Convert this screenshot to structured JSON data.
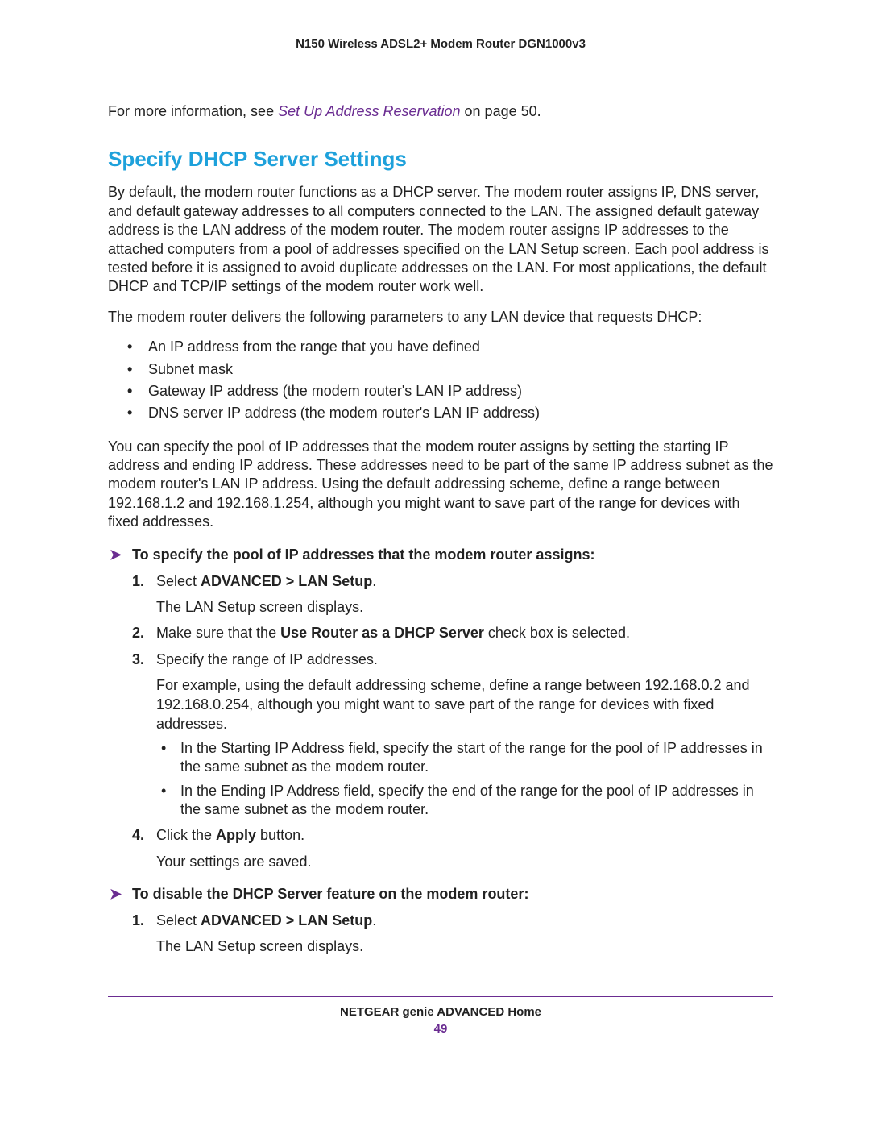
{
  "header": {
    "title": "N150 Wireless ADSL2+ Modem Router DGN1000v3"
  },
  "intro": {
    "prefix": "For more information, see ",
    "link_text": "Set Up Address Reservation",
    "suffix": " on page 50."
  },
  "heading": "Specify DHCP Server Settings",
  "p1": "By default, the modem router functions as a DHCP server. The modem router assigns IP, DNS server, and default gateway addresses to all computers connected to the LAN. The assigned default gateway address is the LAN address of the modem router. The modem router assigns IP addresses to the attached computers from a pool of addresses specified on the LAN Setup screen. Each pool address is tested before it is assigned to avoid duplicate addresses on the LAN. For most applications, the default DHCP and TCP/IP settings of the modem router work well.",
  "p2": "The modem router delivers the following parameters to any LAN device that requests DHCP:",
  "bullets": [
    "An IP address from the range that you have defined",
    "Subnet mask",
    "Gateway IP address (the modem router's LAN IP address)",
    "DNS server IP address (the modem router's LAN IP address)"
  ],
  "p3": "You can specify the pool of IP addresses that the modem router assigns by setting the starting IP address and ending IP address. These addresses need to be part of the same IP address subnet as the modem router's LAN IP address. Using the default addressing scheme, define a range between 192.168.1.2 and 192.168.1.254, although you might want to save part of the range for devices with fixed addresses.",
  "proc1": {
    "title": "To specify the pool of IP addresses that the modem router assigns:",
    "steps": {
      "s1_pre": "Select ",
      "s1_bold": "ADVANCED > LAN Setup",
      "s1_post": ".",
      "s1_sub": "The LAN Setup screen displays.",
      "s2_pre": "Make sure that the ",
      "s2_bold": "Use Router as a DHCP Server",
      "s2_post": " check box is selected.",
      "s3_main": "Specify the range of IP addresses.",
      "s3_sub": "For example, using the default addressing scheme, define a range between 192.168.0.2 and 192.168.0.254, although you might want to save part of the range for devices with fixed addresses.",
      "s3_i1": "In the Starting IP Address field, specify the start of the range for the pool of IP addresses in the same subnet as the modem router.",
      "s3_i2": "In the Ending IP Address field, specify the end of the range for the pool of IP addresses in the same subnet as the modem router.",
      "s4_pre": "Click the ",
      "s4_bold": "Apply",
      "s4_post": " button.",
      "s4_sub": "Your settings are saved."
    }
  },
  "proc2": {
    "title": "To disable the DHCP Server feature on the modem router:",
    "steps": {
      "s1_pre": "Select ",
      "s1_bold": "ADVANCED > LAN Setup",
      "s1_post": ".",
      "s1_sub": "The LAN Setup screen displays."
    }
  },
  "footer": {
    "text": "NETGEAR genie ADVANCED Home",
    "page": "49"
  }
}
